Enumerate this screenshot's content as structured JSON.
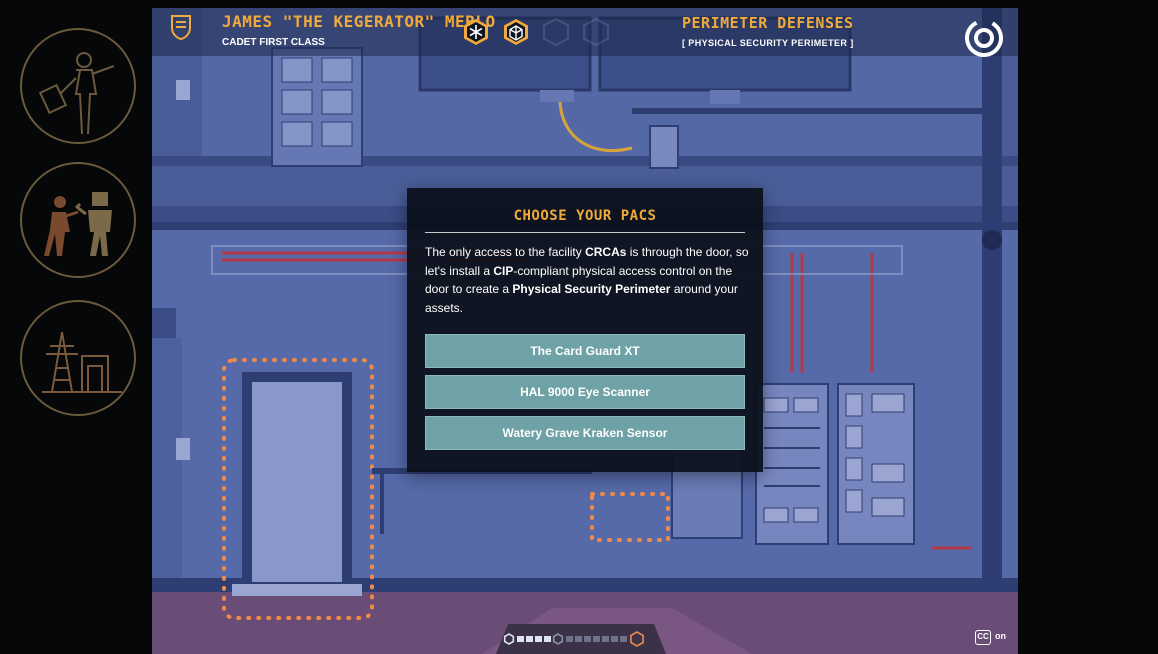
{
  "hud": {
    "player_name": "JAMES \"THE KEGERATOR\" MERLO",
    "player_rank": "CADET FIRST CLASS",
    "level_title": "PERIMETER DEFENSES",
    "level_subtitle": "[ PHYSICAL SECURITY PERIMETER ]",
    "badges": [
      "snowflake-badge-icon",
      "cube-badge-icon",
      "locked-badge-icon",
      "locked-badge-icon"
    ]
  },
  "chapters": [
    {
      "icon": "inspector-clipboard-icon"
    },
    {
      "icon": "person-vs-robot-icon"
    },
    {
      "icon": "power-tower-substation-icon"
    }
  ],
  "modal": {
    "title": "CHOOSE YOUR PACS",
    "body": [
      {
        "text": "The only access to the facility ",
        "bold": false
      },
      {
        "text": "CRCAs",
        "bold": true
      },
      {
        "text": " is through the door, so let's install a ",
        "bold": false
      },
      {
        "text": "CIP",
        "bold": true
      },
      {
        "text": "-compliant physical access control on the door to create a ",
        "bold": false
      },
      {
        "text": "Physical Security Perimeter",
        "bold": true
      },
      {
        "text": " around your assets.",
        "bold": false
      }
    ],
    "choices": [
      "The Card Guard XT",
      "HAL 9000 Eye Scanner",
      "Watery Grave Kraken Sensor"
    ]
  },
  "captions": {
    "label": "CC",
    "state": "on"
  },
  "progress": {
    "segments_total": 13,
    "current_segment": 5
  },
  "colors": {
    "accent": "#f0a93b",
    "scene_bg": "#4a5d98",
    "choice_bg": "#6fa2a6",
    "highlight": "#f08a4b",
    "modal_bg": "#0a0e18"
  }
}
